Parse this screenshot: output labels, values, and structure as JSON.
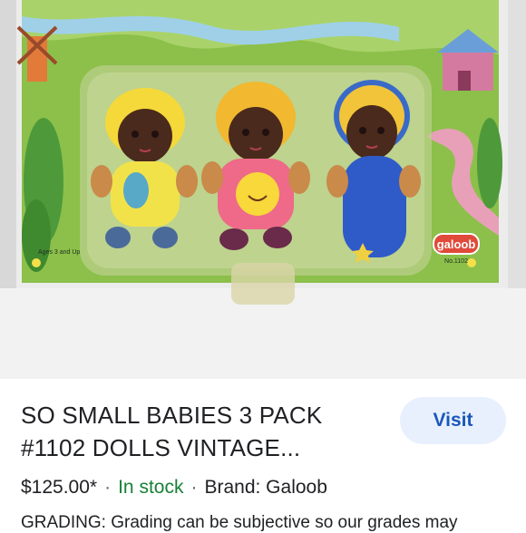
{
  "product": {
    "title_line1": "SO SMALL BABIES 3 PACK",
    "title_line2": "#1102 DOLLS VINTAGE...",
    "price": "$125.00*",
    "stock": "In stock",
    "brand": "Brand: Galoob",
    "description": "GRADING: Grading can be subjective so our grades may",
    "visit_label": "Visit"
  },
  "image": {
    "package_brand": "galoob",
    "package_item_no": "No.1102",
    "package_age_text": "Ages 3 and Up"
  }
}
